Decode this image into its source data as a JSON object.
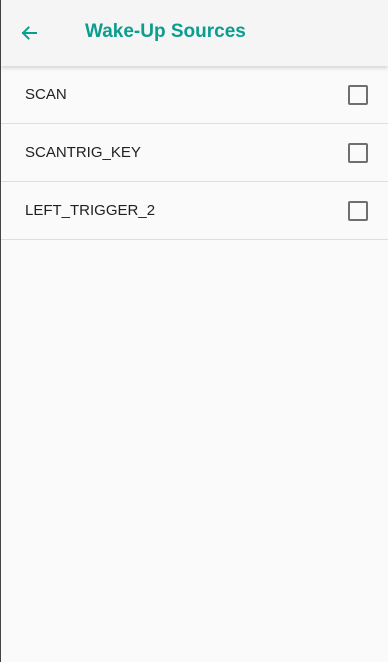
{
  "app_bar": {
    "back_icon": "arrow-left-icon",
    "title": "Wake-Up Sources"
  },
  "colors": {
    "accent": "#0a9e8f",
    "app_bar_bg": "#f5f5f5",
    "list_bg": "#fafafa",
    "divider": "#dedede"
  },
  "sources": [
    {
      "label": "SCAN",
      "checked": false
    },
    {
      "label": "SCANTRIG_KEY",
      "checked": false
    },
    {
      "label": "LEFT_TRIGGER_2",
      "checked": false
    }
  ]
}
